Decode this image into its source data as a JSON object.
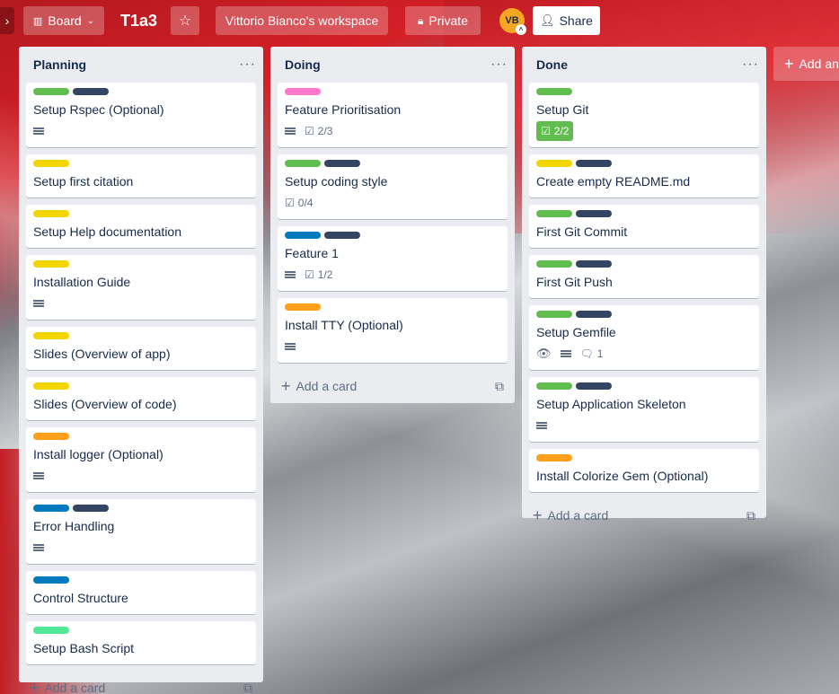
{
  "header": {
    "board_button": "Board",
    "board_title": "T1a3",
    "workspace": "Vittorio Bianco's workspace",
    "visibility": "Private",
    "avatar_initials": "VB",
    "share": "Share"
  },
  "colors": {
    "green": "#61bd4f",
    "dark": "#344563",
    "yellow": "#f2d600",
    "orange": "#ff9f1a",
    "blue": "#0079bf",
    "pink": "#ff78cb",
    "lime": "#51e898"
  },
  "lists": [
    {
      "title": "Planning",
      "add_card": "Add a card",
      "cards": [
        {
          "title": "Setup Rspec (Optional)",
          "labels": [
            "green",
            "dark"
          ],
          "description": true,
          "checklist": ""
        },
        {
          "title": "Setup first citation",
          "labels": [
            "yellow"
          ],
          "description": false,
          "checklist": ""
        },
        {
          "title": "Setup Help documentation",
          "labels": [
            "yellow"
          ],
          "description": false,
          "checklist": ""
        },
        {
          "title": "Installation Guide",
          "labels": [
            "yellow"
          ],
          "description": true,
          "checklist": ""
        },
        {
          "title": "Slides (Overview of app)",
          "labels": [
            "yellow"
          ],
          "description": false,
          "checklist": ""
        },
        {
          "title": "Slides (Overview of code)",
          "labels": [
            "yellow"
          ],
          "description": false,
          "checklist": ""
        },
        {
          "title": "Install logger (Optional)",
          "labels": [
            "orange"
          ],
          "description": true,
          "checklist": ""
        },
        {
          "title": "Error Handling",
          "labels": [
            "blue",
            "dark"
          ],
          "description": true,
          "checklist": ""
        },
        {
          "title": "Control Structure",
          "labels": [
            "blue"
          ],
          "description": false,
          "checklist": ""
        },
        {
          "title": "Setup Bash Script",
          "labels": [
            "lime"
          ],
          "description": false,
          "checklist": ""
        }
      ]
    },
    {
      "title": "Doing",
      "add_card": "Add a card",
      "cards": [
        {
          "title": "Feature Prioritisation",
          "labels": [
            "pink"
          ],
          "description": true,
          "checklist": "2/3"
        },
        {
          "title": "Setup coding style",
          "labels": [
            "green",
            "dark"
          ],
          "description": false,
          "checklist": "0/4"
        },
        {
          "title": "Feature 1",
          "labels": [
            "blue",
            "dark"
          ],
          "description": true,
          "checklist": "1/2"
        },
        {
          "title": "Install TTY (Optional)",
          "labels": [
            "orange"
          ],
          "description": true,
          "checklist": ""
        }
      ]
    },
    {
      "title": "Done",
      "add_card": "Add a card",
      "cards": [
        {
          "title": "Setup Git",
          "labels": [
            "green"
          ],
          "description": false,
          "checklist": "2/2",
          "checklist_complete": true
        },
        {
          "title": "Create empty README.md",
          "labels": [
            "yellow",
            "dark"
          ],
          "description": false,
          "checklist": ""
        },
        {
          "title": "First Git Commit",
          "labels": [
            "green",
            "dark"
          ],
          "description": false,
          "checklist": ""
        },
        {
          "title": "First Git Push",
          "labels": [
            "green",
            "dark"
          ],
          "description": false,
          "checklist": ""
        },
        {
          "title": "Setup Gemfile",
          "labels": [
            "green",
            "dark"
          ],
          "description": true,
          "checklist": "",
          "watching": true,
          "comments": "1"
        },
        {
          "title": "Setup Application Skeleton",
          "labels": [
            "green",
            "dark"
          ],
          "description": true,
          "checklist": ""
        },
        {
          "title": "Install Colorize Gem (Optional)",
          "labels": [
            "orange"
          ],
          "description": false,
          "checklist": ""
        }
      ]
    }
  ],
  "add_list": "Add another list"
}
